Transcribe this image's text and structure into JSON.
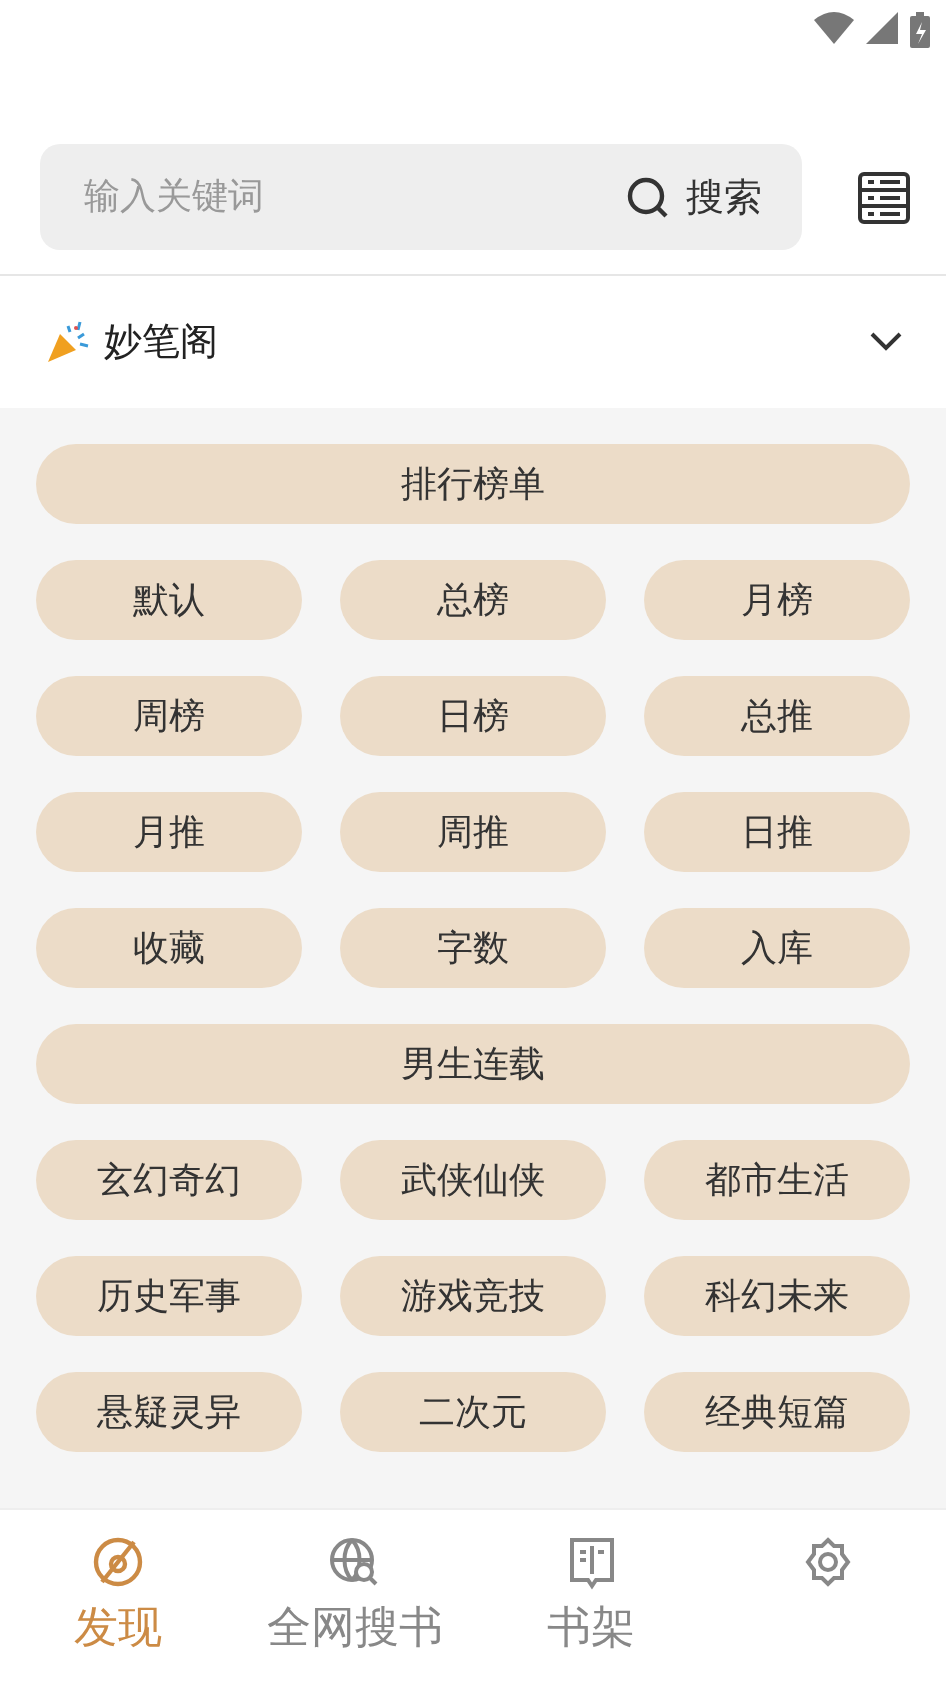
{
  "search": {
    "placeholder": "输入关键词",
    "button": "搜索"
  },
  "source": {
    "name": "妙笔阁",
    "expanded": false
  },
  "sections": [
    {
      "title": "排行榜单",
      "items": [
        "默认",
        "总榜",
        "月榜",
        "周榜",
        "日榜",
        "总推",
        "月推",
        "周推",
        "日推",
        "收藏",
        "字数",
        "入库"
      ]
    },
    {
      "title": "男生连载",
      "items": [
        "玄幻奇幻",
        "武侠仙侠",
        "都市生活",
        "历史军事",
        "游戏竞技",
        "科幻未来",
        "悬疑灵异",
        "二次元",
        "经典短篇"
      ]
    }
  ],
  "nav": [
    {
      "kind": "discover",
      "label": "发现",
      "selected": true
    },
    {
      "kind": "websearch",
      "label": "全网搜书",
      "selected": false
    },
    {
      "kind": "shelf",
      "label": "书架",
      "selected": false
    },
    {
      "kind": "settings",
      "selected": false
    }
  ]
}
